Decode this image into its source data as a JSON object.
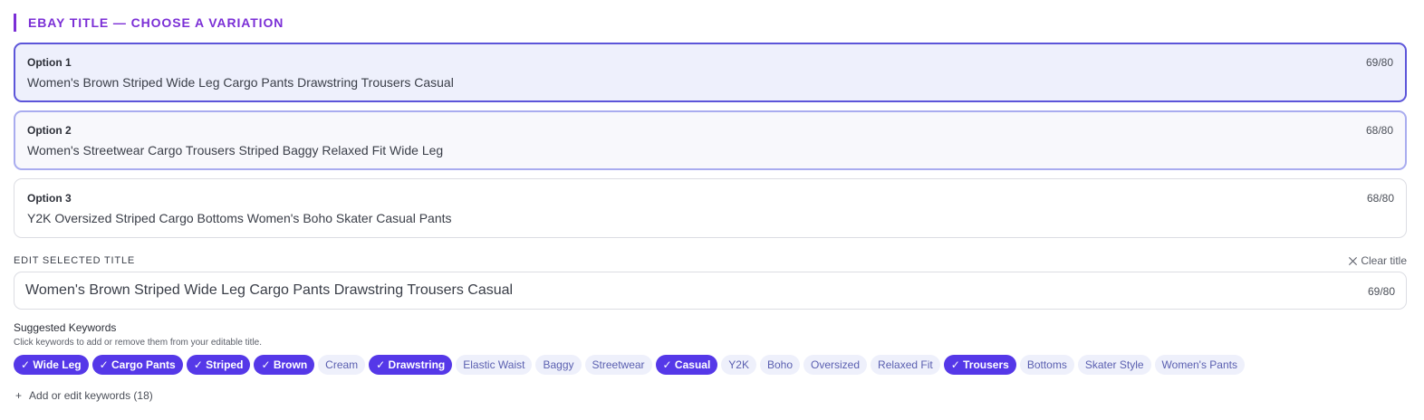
{
  "section": {
    "title": "EBAY TITLE — CHOOSE A VARIATION"
  },
  "options": [
    {
      "label": "Option 1",
      "count": "69/80",
      "text": "Women's Brown Striped Wide Leg Cargo Pants Drawstring Trousers Casual"
    },
    {
      "label": "Option 2",
      "count": "68/80",
      "text": "Women's Streetwear Cargo Trousers Striped Baggy Relaxed Fit Wide Leg"
    },
    {
      "label": "Option 3",
      "count": "68/80",
      "text": "Y2K Oversized Striped Cargo Bottoms Women's Boho Skater Casual Pants"
    }
  ],
  "edit": {
    "label": "EDIT SELECTED TITLE",
    "clear_label": "Clear title",
    "value": "Women's Brown Striped Wide Leg Cargo Pants Drawstring Trousers Casual",
    "count": "69/80"
  },
  "keywords": {
    "heading": "Suggested Keywords",
    "hint": "Click keywords to add or remove them from your editable title.",
    "chips": [
      {
        "label": "✓ Wide Leg",
        "selected": true
      },
      {
        "label": "✓ Cargo Pants",
        "selected": true
      },
      {
        "label": "✓ Striped",
        "selected": true
      },
      {
        "label": "✓ Brown",
        "selected": true
      },
      {
        "label": "Cream",
        "selected": false
      },
      {
        "label": "✓ Drawstring",
        "selected": true
      },
      {
        "label": "Elastic Waist",
        "selected": false
      },
      {
        "label": "Baggy",
        "selected": false
      },
      {
        "label": "Streetwear",
        "selected": false
      },
      {
        "label": "✓ Casual",
        "selected": true
      },
      {
        "label": "Y2K",
        "selected": false
      },
      {
        "label": "Boho",
        "selected": false
      },
      {
        "label": "Oversized",
        "selected": false
      },
      {
        "label": "Relaxed Fit",
        "selected": false
      },
      {
        "label": "✓ Trousers",
        "selected": true
      },
      {
        "label": "Bottoms",
        "selected": false
      },
      {
        "label": "Skater Style",
        "selected": false
      },
      {
        "label": "Women's Pants",
        "selected": false
      }
    ],
    "add_icon": "+",
    "add_label": "Add or edit keywords (18)"
  },
  "colors": {
    "accent": "#7b2fd6",
    "chip_selected": "#5538e8",
    "chip_unselected": "#eef0fb",
    "selected_border": "#5c55d9"
  }
}
